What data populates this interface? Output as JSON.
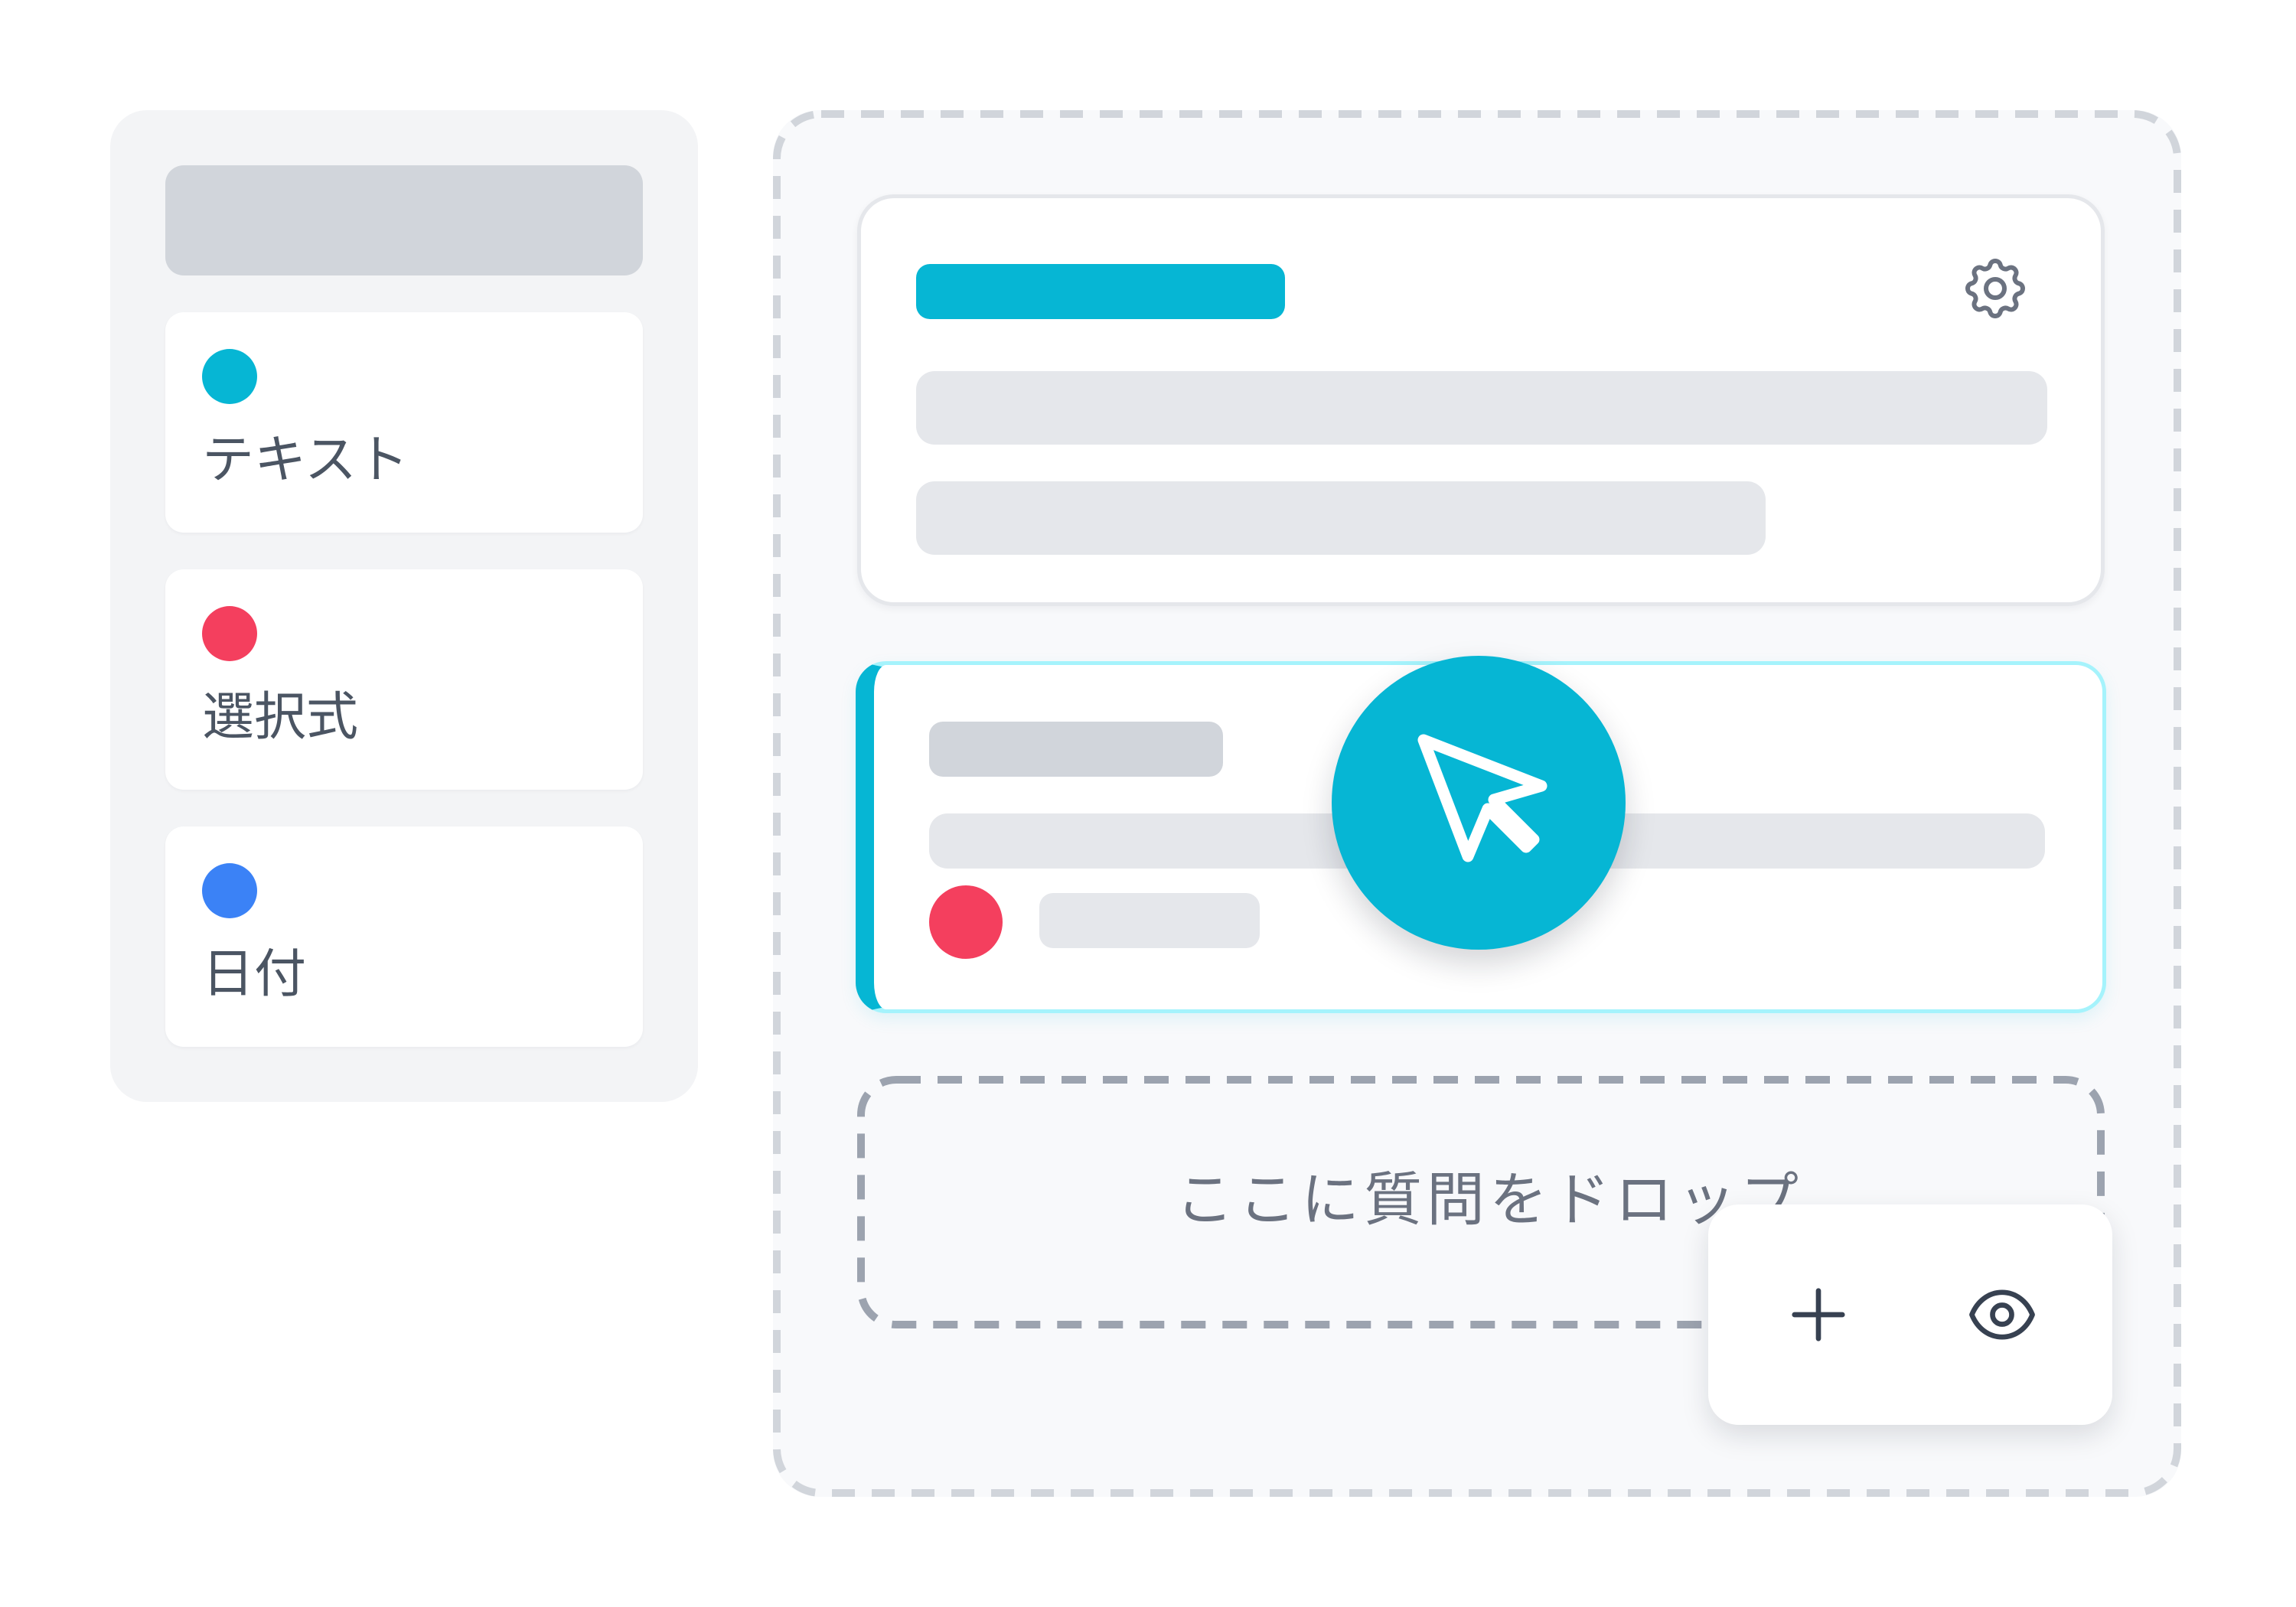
{
  "palette": {
    "items": [
      {
        "label": "テキスト",
        "color": "#06b6d4"
      },
      {
        "label": "選択式",
        "color": "#f43f5e"
      },
      {
        "label": "日付",
        "color": "#3b82f6"
      }
    ]
  },
  "canvas": {
    "existing_card": {
      "accent_color": "#06b6d4",
      "settings_icon": "gear-icon"
    },
    "dragging_card": {
      "accent_color": "#06b6d4",
      "dot_color": "#f43f5e",
      "cursor_icon": "pointer-cursor-icon"
    },
    "dropzone": {
      "text": "ここに質問をドロップ"
    }
  },
  "toolbar": {
    "add_icon": "plus-icon",
    "preview_icon": "eye-icon"
  }
}
